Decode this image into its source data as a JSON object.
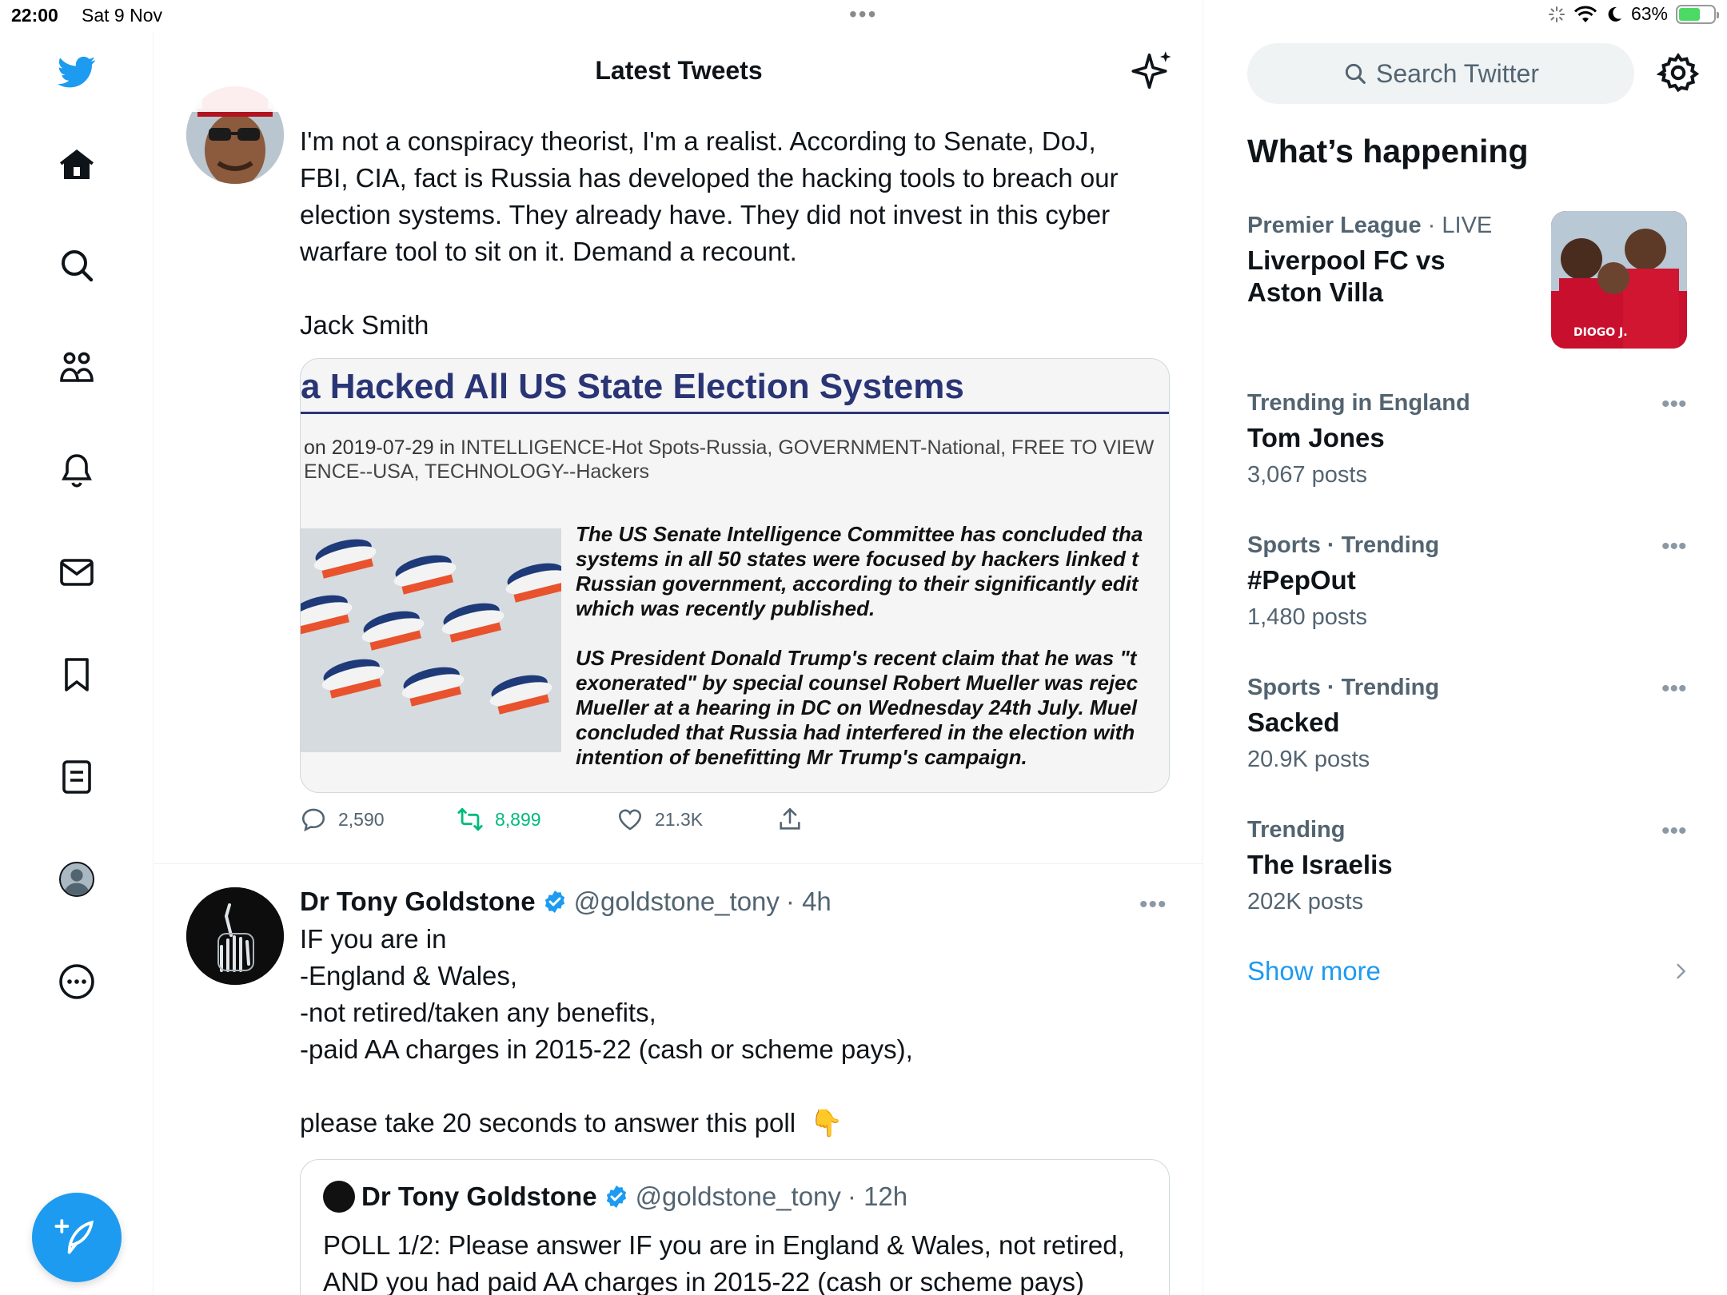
{
  "status": {
    "time": "22:00",
    "date": "Sat 9 Nov",
    "battery": "63%",
    "battery_level": 0.63
  },
  "nav": {
    "icons": [
      "twitter-logo-icon",
      "home-icon",
      "search-icon",
      "communities-icon",
      "notifications-icon",
      "messages-icon",
      "bookmarks-icon",
      "lists-icon",
      "profile-icon",
      "more-icon"
    ],
    "compose_icon": "compose-feather-icon"
  },
  "timeline": {
    "title": "Latest Tweets",
    "tweet1": {
      "text": "I'm not a conspiracy theorist, I'm a realist. According to Senate, DoJ,\nFBI, CIA, fact is Russia has developed the hacking tools to breach our\nelection systems. They already have. They did not invest in this cyber\nwarfare tool to sit on it. Demand a recount.\n\nJack Smith",
      "card": {
        "headline": "a Hacked All US State Election Systems",
        "meta_line1_prefix": "on 2019-07-29 in ",
        "meta_line1_links": "INTELLIGENCE-Hot Spots-Russia, GOVERNMENT-National, FREE TO VIEW",
        "meta_line2": "ENCE--USA, TECHNOLOGY--Hackers",
        "body": "The US Senate Intelligence Committee has concluded tha\nsystems in all 50 states were focused by hackers linked t\nRussian government, according to their significantly edit\nwhich was recently published.\n\nUS President Donald Trump's recent claim that he was \"t\nexonerated\" by special counsel Robert Mueller was rejec\nMueller at a hearing in DC on Wednesday 24th July. Muel\nconcluded that Russia had interfered in the election with\nintention of benefitting Mr Trump's campaign."
      },
      "replies": "2,590",
      "retweets": "8,899",
      "likes": "21.3K"
    },
    "tweet2": {
      "name": "Dr Tony Goldstone",
      "handle": "@goldstone_tony",
      "time": "· 4h",
      "text": "IF you are in\n-England & Wales,\n-not retired/taken any benefits,\n-paid AA charges in 2015-22 (cash or scheme pays),\n\nplease take 20 seconds to answer this poll  👇",
      "quote": {
        "name": "Dr Tony Goldstone",
        "handle": "@goldstone_tony",
        "time": "· 12h",
        "text": "POLL 1/2: Please answer IF you are in England & Wales, not retired,\nAND you had paid AA charges in 2015-22 (cash or scheme pays)"
      }
    }
  },
  "sidebar": {
    "search_placeholder": "Search Twitter",
    "title": "What’s happening",
    "trends": [
      {
        "category": "Premier League",
        "status": " · LIVE",
        "name": "Liverpool FC vs\nAston Villa"
      },
      {
        "category": "Trending in England",
        "name": "Tom Jones",
        "count": "3,067 posts"
      },
      {
        "category": "Sports · Trending",
        "name": "#PepOut",
        "count": "1,480 posts"
      },
      {
        "category": "Sports · Trending",
        "name": "Sacked",
        "count": "20.9K posts"
      },
      {
        "category": "Trending",
        "name": "The Israelis",
        "count": "202K posts"
      }
    ],
    "trend_image_caption": "DIOGO J.",
    "show_more": "Show more"
  },
  "colors": {
    "accent": "#1d9bf0",
    "retweet": "#00ba7c",
    "secondary_text": "#536471",
    "headline_navy": "#2a3575"
  }
}
